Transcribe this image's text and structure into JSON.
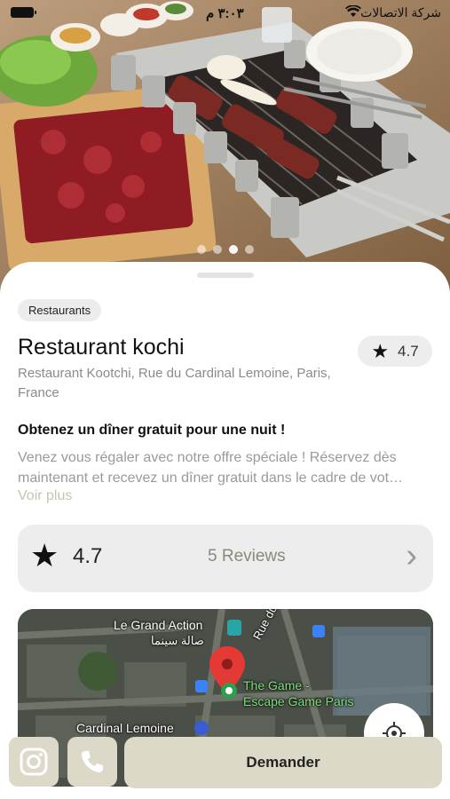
{
  "status_bar": {
    "time": "٣:٠٣ م",
    "carrier": "شركة الاتصالات",
    "wifi_icon": "wifi-icon"
  },
  "gallery": {
    "page_count": 4,
    "active_index": 2
  },
  "category": "Restaurants",
  "restaurant": {
    "name": "Restaurant kochi",
    "rating": "4.7",
    "address": "Restaurant Kootchi, Rue du Cardinal Lemoine, Paris, France"
  },
  "offer": {
    "title": "Obtenez un dîner gratuit pour une nuit !",
    "description_line1": "Venez vous régaler avec notre offre spéciale ! Réservez dès",
    "description_line2": "maintenant et recevez un dîner gratuit dans le cadre de vot…",
    "more_label": "Voir plus"
  },
  "reviews": {
    "rating": "4.7",
    "label": "5 Reviews"
  },
  "map": {
    "labels": {
      "cinema": "Le Grand Action",
      "cinema_ar": "صالة سينما",
      "street": "Rue du Car",
      "poi_line1": "The Game -",
      "poi_line2": "Escape Game Paris",
      "metro": "Cardinal Lemoine"
    }
  },
  "actions": {
    "ask_label": "Demander"
  },
  "colors": {
    "accent_button": "#ddd9c8",
    "muted_text": "#8a8a8a",
    "more_link": "#c8c4b0",
    "pin": "#e53935"
  }
}
